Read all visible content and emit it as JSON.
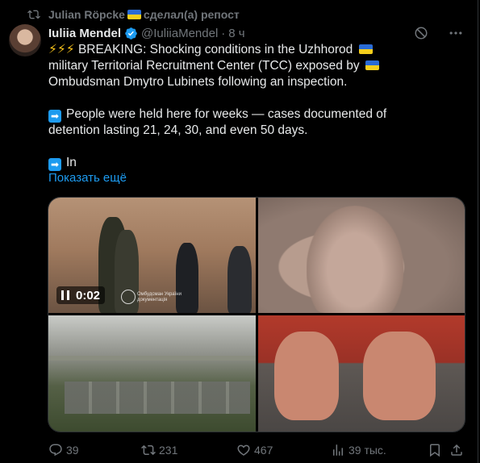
{
  "repost": {
    "user": "Julian Röpcke",
    "suffix": "сделал(а) репост"
  },
  "author": {
    "name": "Iuliia Mendel",
    "handle": "@IuliiaMendel",
    "time": "8 ч"
  },
  "tweet": {
    "lines": [
      "BREAKING: Shocking conditions in the Uzhhorod",
      "military Territorial Recruitment Center (TCC) exposed by",
      "Ombudsman Dmytro Lubinets following an inspection.",
      "People were held here for weeks — cases documented of",
      "detention lasting 21, 24, 30, and even 50 days.",
      "In"
    ],
    "show_more": "Показать ещё"
  },
  "media": {
    "video_time": "0:02",
    "watermark": "Омбудсман України документація"
  },
  "actions": {
    "replies": "39",
    "reposts": "231",
    "likes": "467",
    "views": "39 тыс."
  },
  "colors": {
    "accent": "#1d9bf0",
    "muted": "#71767b",
    "text": "#e7e9ea",
    "background": "#000000"
  },
  "icons": [
    "repost-icon",
    "verified-icon",
    "grok-icon",
    "more-icon",
    "reply-icon",
    "retweet-icon",
    "like-icon",
    "views-icon",
    "bookmark-icon",
    "share-icon"
  ]
}
